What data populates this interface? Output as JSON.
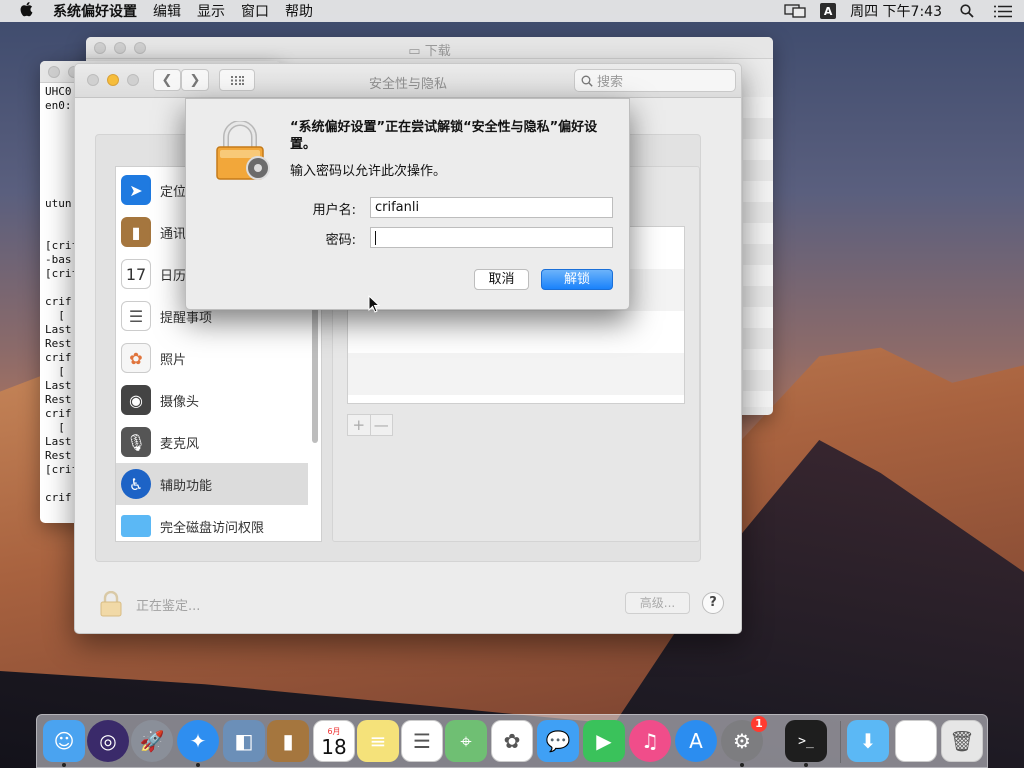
{
  "menubar": {
    "apple": "",
    "app_name": "系统偏好设置",
    "items": [
      "编辑",
      "显示",
      "窗口",
      "帮助"
    ],
    "input_label": "A",
    "clock": "周四 下午7:43"
  },
  "download_window": {
    "title": "下载"
  },
  "terminal_window": {
    "lines": [
      "UHC0",
      "en0:",
      "",
      "",
      "",
      "",
      "",
      "",
      "utun",
      "",
      "",
      "[crif",
      "-bas",
      "[crif",
      "",
      "crif",
      "  [",
      "Last",
      "Rest",
      "crif",
      "  [",
      "Last",
      "Rest",
      "crif",
      "  [",
      "Last",
      "Rest",
      "[crif",
      "",
      "crif"
    ]
  },
  "main_window": {
    "title": "安全性与隐私",
    "search_placeholder": "搜索",
    "sidebar": [
      {
        "label": "定位服务",
        "icon": "location-icon",
        "color": "#1f7ae0"
      },
      {
        "label": "通讯录",
        "icon": "contacts-icon",
        "color": "#a5763e"
      },
      {
        "label": "日历",
        "icon": "calendar-icon",
        "color": "#ffffff"
      },
      {
        "label": "提醒事项",
        "icon": "reminders-icon",
        "color": "#ffffff"
      },
      {
        "label": "照片",
        "icon": "photos-icon",
        "color": "#f6f6f6"
      },
      {
        "label": "摄像头",
        "icon": "camera-icon",
        "color": "#444444"
      },
      {
        "label": "麦克风",
        "icon": "microphone-icon",
        "color": "#555555"
      },
      {
        "label": "辅助功能",
        "icon": "accessibility-icon",
        "color": "#1d63c6"
      },
      {
        "label": "完全磁盘访问权限",
        "icon": "folder-icon",
        "color": "#5bb8f5"
      }
    ],
    "selected_index": 7,
    "plus_label": "+",
    "minus_label": "—",
    "status": "正在鉴定...",
    "advanced_button": "高级...",
    "help_button": "?"
  },
  "dialog": {
    "title": "“系统偏好设置”正在尝试解锁“安全性与隐私”偏好设置。",
    "subtitle": "输入密码以允许此次操作。",
    "username_label": "用户名:",
    "username_value": "crifanli",
    "password_label": "密码:",
    "password_value": "",
    "cancel_button": "取消",
    "unlock_button": "解锁"
  },
  "dock": {
    "calendar_day": "18",
    "calendar_month": "6月",
    "system_prefs_badge": "1",
    "items": [
      {
        "name": "finder",
        "color": "#4aa3f0"
      },
      {
        "name": "siri",
        "color": "#3a2a6a"
      },
      {
        "name": "launchpad",
        "color": "#8a8f99"
      },
      {
        "name": "safari",
        "color": "#2e8ef0"
      },
      {
        "name": "preview",
        "color": "#6b8fb8"
      },
      {
        "name": "contacts",
        "color": "#a5763e"
      },
      {
        "name": "calendar",
        "color": "#ffffff"
      },
      {
        "name": "notes",
        "color": "#f5e27a"
      },
      {
        "name": "reminders",
        "color": "#ffffff"
      },
      {
        "name": "maps",
        "color": "#6fbf73"
      },
      {
        "name": "photos",
        "color": "#ffffff"
      },
      {
        "name": "messages",
        "color": "#3fa0f5"
      },
      {
        "name": "facetime",
        "color": "#3ac25b"
      },
      {
        "name": "itunes",
        "color": "#f04d8a"
      },
      {
        "name": "app-store",
        "color": "#2b8df0"
      },
      {
        "name": "system-preferences",
        "color": "#7d7d80"
      },
      {
        "name": "terminal",
        "color": "#1e1e1e"
      },
      {
        "name": "downloads-folder",
        "color": "#5bb8f5"
      },
      {
        "name": "recent-window",
        "color": "#ffffff"
      },
      {
        "name": "trash",
        "color": "#e6e6e6"
      }
    ]
  }
}
